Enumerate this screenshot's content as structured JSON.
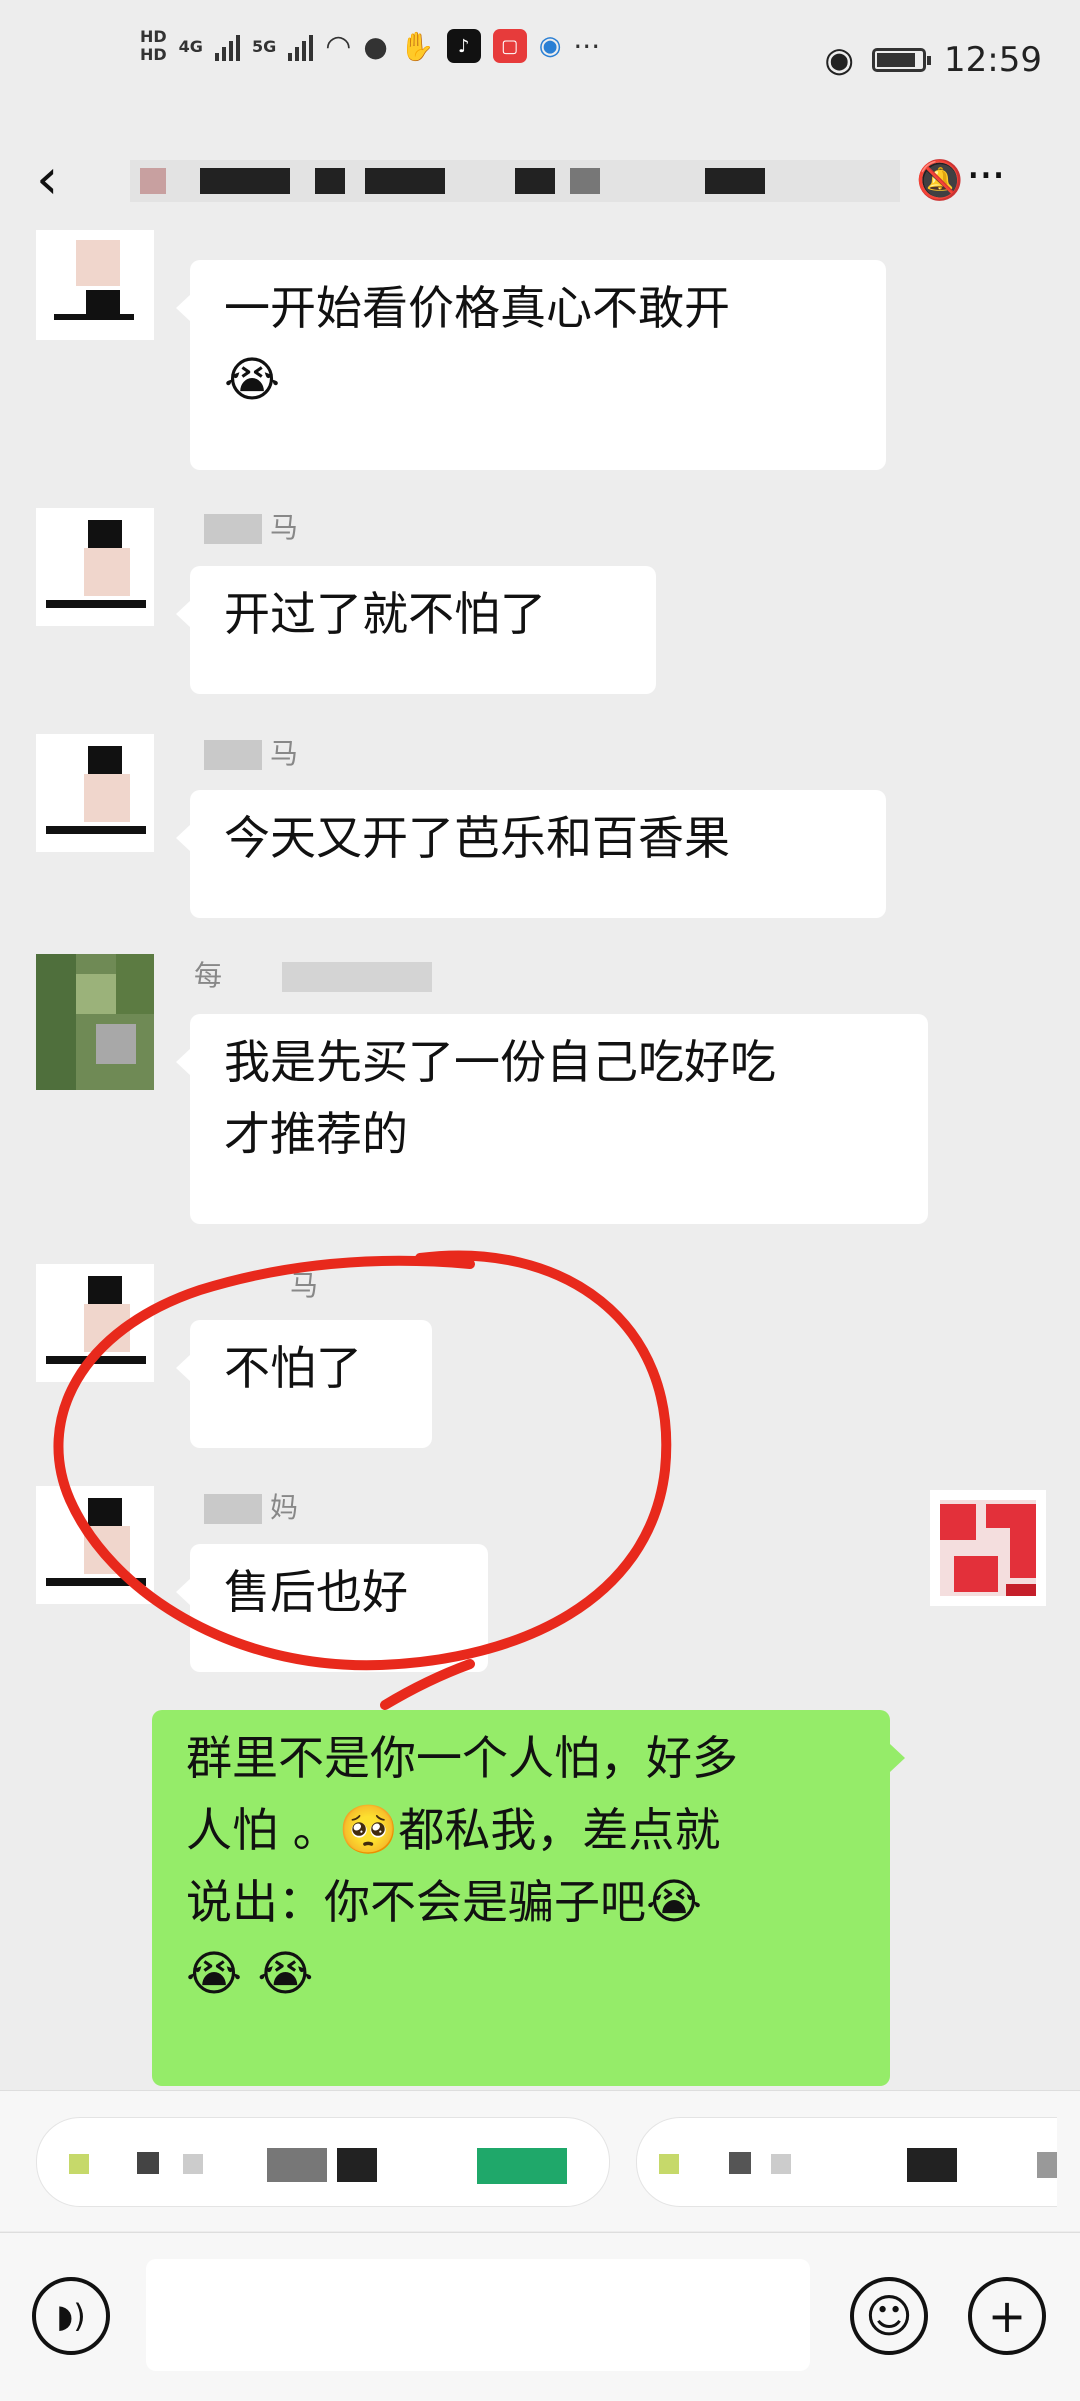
{
  "status_bar": {
    "hd_top": "HD",
    "hd_bottom": "HD",
    "net1": "4G",
    "net2": "5G",
    "overflow": "···",
    "time": "12:59",
    "battery_level": 0.8
  },
  "header": {
    "back_icon": "chevron-left-icon",
    "mute_icon": "bell-off-icon",
    "more_label": "···"
  },
  "messages": [
    {
      "side": "left",
      "nickname": "",
      "text": "一开始看价格真心不敢开",
      "emoji": "😭"
    },
    {
      "side": "left",
      "nickname": "马",
      "text": "开过了就不怕了"
    },
    {
      "side": "left",
      "nickname": "马",
      "text": "今天又开了芭乐和百香果"
    },
    {
      "side": "left",
      "nickname": "每",
      "text_line1": "我是先买了一份自己吃好吃",
      "text_line2": "才推荐的"
    },
    {
      "side": "left",
      "nickname": "马",
      "text": "不怕了"
    },
    {
      "side": "left",
      "nickname": "妈",
      "text": "售后也好"
    },
    {
      "side": "right",
      "line1": "群里不是你一个人怕，好多",
      "line2a": "人怕 。",
      "line2_emoji": "🥺",
      "line2b": "都私我，差点就",
      "line3": "说出：你不会是骗子吧",
      "line3_emoji": "😭",
      "line4_emojis": "😭 😭"
    }
  ],
  "annotation": {
    "color": "#e8291c"
  },
  "input_bar": {
    "voice_icon": "voice-icon",
    "emoji_icon": "smile-icon",
    "plus_label": "+"
  },
  "colors": {
    "background": "#ededed",
    "my_bubble": "#95ec69",
    "other_bubble": "#ffffff"
  }
}
